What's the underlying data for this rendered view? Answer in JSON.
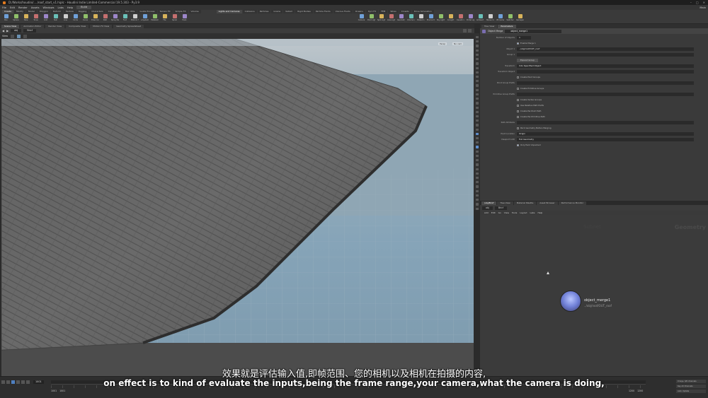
{
  "window": {
    "title": "D:/Works/houdini/..../roof_start_v1.hiplc - Houdini Indie Limited-Commercial 19.5.303 - Py3.9",
    "controls": [
      "–",
      "□",
      "✕"
    ]
  },
  "menu": {
    "items": [
      "File",
      "Edit",
      "Render",
      "Assets",
      "Windows",
      "Labs",
      "Help"
    ],
    "desktop": "Build",
    "main": "Main"
  },
  "shelf": {
    "left_tabs": [
      "Create",
      "Modify",
      "Model",
      "Polygon",
      "Deform",
      "Texture",
      "Rigging",
      "Characters",
      "Constraints",
      "Hair Utils",
      "Guide Process",
      "Terrain FX",
      "Simple FX",
      "Volume"
    ],
    "right_tabs": [
      "Lights and Cameras",
      "Collisions",
      "Particles",
      "Grains",
      "Vellum",
      "Rigid Bodies",
      "Particle Fluids",
      "Viscous Fluids",
      "Oceans",
      "Pyro FX",
      "FEM",
      "Wires",
      "Crowds",
      "Drive Simulation"
    ],
    "left_tools": [
      "Box",
      "Sphere",
      "Tube",
      "Torus",
      "Grid",
      "Null",
      "Line",
      "Circle",
      "Curve",
      "Draw Curve",
      "Path",
      "Spray Paint",
      "Font",
      "Platonic Solids",
      "L-System",
      "Metaball",
      "File",
      "Spiral",
      "Helix"
    ],
    "right_tools": [
      "Camera",
      "Point Light",
      "Spot Light",
      "Area Light",
      "Geometry Light",
      "Volume Light",
      "Distant Light",
      "Environment Light",
      "Sky Light",
      "GI Light",
      "Caustic Light",
      "Portal Light",
      "Ambient Light",
      "Stereo Camera",
      "VR Camera",
      "Switcher",
      "Gamepad Camera"
    ]
  },
  "viewer": {
    "pane_tabs": [
      "Scene View",
      "Animation Editor",
      "Render View",
      "Composite View",
      "Motion FX View",
      "Geometry Spreadsheet"
    ],
    "path": "obj",
    "object": "Bricf",
    "view_name": "View",
    "persp_label": "Persp",
    "cam_label": "No cam"
  },
  "parameters": {
    "pane_tabs": [
      "Tree View",
      "Parameters"
    ],
    "node_type": "Object Merge",
    "node_name": "object_merge1",
    "rows": [
      {
        "label": "Number of Objects",
        "value": "1"
      },
      {
        "label": "",
        "check": "Enable Merge 1",
        "on": true
      },
      {
        "label": "Object 1",
        "value": "../obj/roof/OUT_roof"
      },
      {
        "label": "Group 1",
        "value": ""
      },
      {
        "label": "",
        "button": "Expand Group"
      },
      {
        "label": "Transform",
        "value": "Into Specified Object"
      },
      {
        "label": "Transform Object",
        "value": ""
      },
      {
        "label": "",
        "check": "Create Point Groups",
        "on": false
      },
      {
        "label": "Point Group Prefix",
        "value": ""
      },
      {
        "label": "",
        "check": "Create Primitive Groups",
        "on": false
      },
      {
        "label": "Primitive Group Prefix",
        "value": ""
      },
      {
        "label": "",
        "check": "Create Vertex Groups",
        "on": false
      },
      {
        "label": "",
        "check": "Use Relative Path Prefix",
        "on": false
      },
      {
        "label": "",
        "check": "Create Per-Point Path",
        "on": false
      },
      {
        "label": "",
        "check": "Create Per-Primitive Path",
        "on": false
      },
      {
        "label": "Path Attribute",
        "value": ""
      },
      {
        "label": "",
        "check": "Pack Geometry Before Merging",
        "on": false
      },
      {
        "label": "Pivot Location",
        "value": "Origin"
      },
      {
        "label": "Viewport LOD",
        "value": "Full Geometry"
      },
      {
        "label": "",
        "check": "Only Pack Unpacked",
        "on": true
      }
    ]
  },
  "network": {
    "pane_tabs": [
      "/obj/Bricf",
      "Tree View",
      "Material Palette",
      "Asset Browser",
      "Performance Monitor"
    ],
    "path": "obj",
    "object": "Bricf",
    "menu": [
      "Add",
      "Edit",
      "Go",
      "View",
      "Tools",
      "Layout",
      "Labs",
      "Help"
    ],
    "context_label": "Geometry",
    "subnet_label": "Subnet",
    "node": {
      "name": "object_merge1",
      "path": "../obj/roof/OUT_roof"
    }
  },
  "subtitles": {
    "cn": "效果就是评估输入值,即帧范围、您的相机以及相机在拍摄的内容,",
    "en": "on effect is to kind of evaluate the inputs,being the frame range,your camera,what the camera is doing,"
  },
  "playbar": {
    "frame": "1001",
    "start": "1001",
    "start2": "1001",
    "end": "1200",
    "end2": "1200",
    "keys": [
      "0 keys, 0/0 channels",
      "Key All Channels",
      "Auto Update"
    ]
  },
  "colors": {
    "accent": "#e07a1f",
    "node": "#6f7fd6",
    "sky": "#9fb1bc"
  }
}
